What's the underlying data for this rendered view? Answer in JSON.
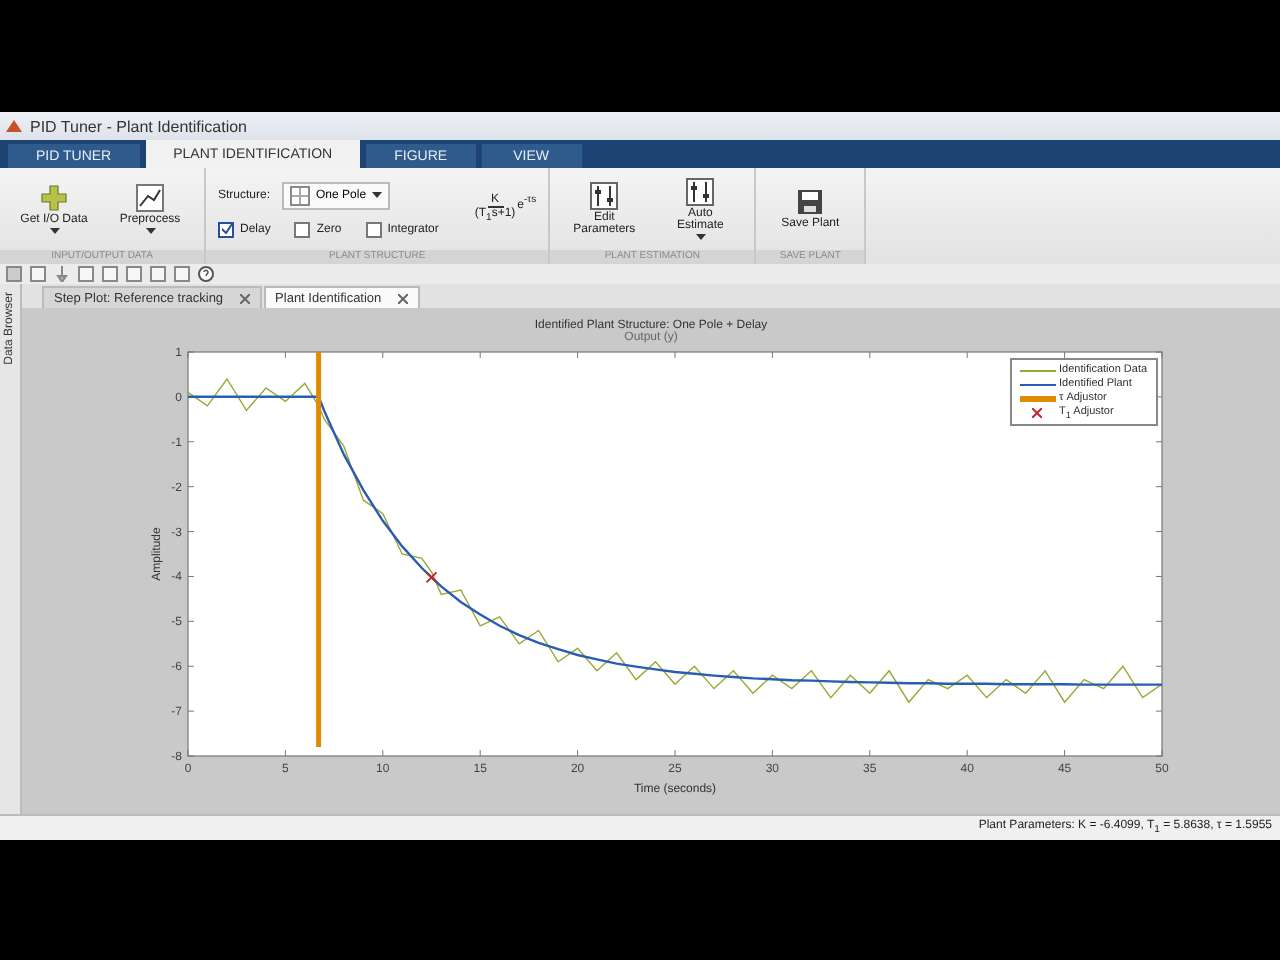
{
  "window": {
    "title": "PID Tuner - Plant Identification"
  },
  "tabs": [
    {
      "label": "PID TUNER",
      "selected": false
    },
    {
      "label": "PLANT IDENTIFICATION",
      "selected": true
    },
    {
      "label": "FIGURE",
      "selected": false
    },
    {
      "label": "VIEW",
      "selected": false
    }
  ],
  "io_data": {
    "label": "INPUT/OUTPUT DATA",
    "buttons": [
      {
        "kind": "plus",
        "label": "Get I/O Data"
      },
      {
        "kind": "chart",
        "label": "Preprocess"
      }
    ]
  },
  "plant_structure": {
    "label": "PLANT STRUCTURE",
    "structure_label": "Structure:",
    "structure_value": "One Pole",
    "numerator": "K",
    "denominator": "(T$_{1}$s+1)",
    "exponent": "e$^{-τs}$",
    "options": [
      {
        "label": "Delay",
        "checked": true
      },
      {
        "label": "Zero",
        "checked": false
      },
      {
        "label": "Integrator",
        "checked": false
      }
    ]
  },
  "plant_estimation": {
    "label": "PLANT ESTIMATION",
    "buttons": [
      {
        "label": "Edit Parameters",
        "dropdown": false
      },
      {
        "label": "Auto Estimate",
        "dropdown": true
      }
    ]
  },
  "save_plant": {
    "label": "SAVE PLANT",
    "button": "Save Plant"
  },
  "side_panel": {
    "label": "Data Browser"
  },
  "document_tabs": [
    {
      "label": "Step Plot: Reference tracking",
      "selected": false
    },
    {
      "label": "Plant Identification",
      "selected": true
    }
  ],
  "figure": {
    "title": "Identified Plant Structure: One Pole + Delay",
    "subtitle": "Output (y)",
    "chart_data": {
      "type": "line",
      "xlabel": "Time (seconds)",
      "ylabel": "Amplitude",
      "x": [
        0,
        1,
        2,
        3,
        4,
        5,
        6,
        6.7,
        6.7,
        7,
        8,
        9,
        10,
        11,
        12,
        12.5,
        13,
        14,
        15,
        16,
        17,
        18,
        19,
        20,
        21,
        22,
        23,
        24,
        25,
        26,
        27,
        28,
        29,
        30,
        31,
        32,
        33,
        34,
        35,
        36,
        37,
        38,
        39,
        40,
        41,
        42,
        43,
        44,
        45,
        46,
        47,
        48,
        49,
        50
      ],
      "series": [
        {
          "name": "Identification Data",
          "color": "#9aa832",
          "values": [
            0.1,
            -0.2,
            0.4,
            -0.3,
            0.2,
            -0.1,
            0.3,
            -0.2,
            -0.2,
            -0.5,
            -1.1,
            -2.3,
            -2.6,
            -3.5,
            -3.6,
            -3.9,
            -4.4,
            -4.3,
            -5.1,
            -4.9,
            -5.5,
            -5.2,
            -5.9,
            -5.6,
            -6.1,
            -5.7,
            -6.3,
            -5.9,
            -6.4,
            -6.0,
            -6.5,
            -6.1,
            -6.6,
            -6.2,
            -6.5,
            -6.1,
            -6.7,
            -6.2,
            -6.6,
            -6.1,
            -6.8,
            -6.3,
            -6.5,
            -6.2,
            -6.7,
            -6.3,
            -6.6,
            -6.1,
            -6.8,
            -6.3,
            -6.5,
            -6.0,
            -6.7,
            -6.4
          ]
        },
        {
          "name": "Identified Plant",
          "color": "#2a5db0",
          "values": [
            0,
            0,
            0,
            0,
            0,
            0,
            0,
            0,
            0,
            -0.32,
            -1.28,
            -2.08,
            -2.76,
            -3.33,
            -3.81,
            -4.02,
            -4.22,
            -4.57,
            -4.85,
            -5.1,
            -5.31,
            -5.48,
            -5.62,
            -5.75,
            -5.85,
            -5.94,
            -6.01,
            -6.07,
            -6.13,
            -6.17,
            -6.21,
            -6.24,
            -6.27,
            -6.29,
            -6.31,
            -6.32,
            -6.34,
            -6.35,
            -6.36,
            -6.37,
            -6.38,
            -6.38,
            -6.39,
            -6.39,
            -6.39,
            -6.4,
            -6.4,
            -6.4,
            -6.4,
            -6.41,
            -6.41,
            -6.41,
            -6.41,
            -6.41
          ]
        },
        {
          "name": "τ Adjustor",
          "color": "#e08a00",
          "values": [
            null,
            null,
            null,
            null,
            null,
            null,
            null,
            1,
            -7.8,
            null,
            null,
            null,
            null,
            null,
            null,
            null,
            null,
            null,
            null,
            null,
            null,
            null,
            null,
            null,
            null,
            null,
            null,
            null,
            null,
            null,
            null,
            null,
            null,
            null,
            null,
            null,
            null,
            null,
            null,
            null,
            null,
            null,
            null,
            null,
            null,
            null,
            null,
            null,
            null,
            null,
            null,
            null,
            null,
            null
          ]
        },
        {
          "name": "T$_{1}$ Adjustor",
          "color": "#c0282d",
          "marker": "x",
          "values": [
            null,
            null,
            null,
            null,
            null,
            null,
            null,
            null,
            null,
            null,
            null,
            null,
            null,
            null,
            null,
            -4.02,
            null,
            null,
            null,
            null,
            null,
            null,
            null,
            null,
            null,
            null,
            null,
            null,
            null,
            null,
            null,
            null,
            null,
            null,
            null,
            null,
            null,
            null,
            null,
            null,
            null,
            null,
            null,
            null,
            null,
            null,
            null,
            null,
            null,
            null,
            null,
            null,
            null,
            null
          ]
        }
      ],
      "xlim": [
        0,
        50
      ],
      "ylim": [
        -8,
        1
      ],
      "xticks": [
        0,
        5,
        10,
        15,
        20,
        25,
        30,
        35,
        40,
        45,
        50
      ],
      "yticks": [
        -8,
        -7,
        -6,
        -5,
        -4,
        -3,
        -2,
        -1,
        0,
        1
      ],
      "legend": "upper right"
    }
  },
  "status_bar": {
    "text": "Plant Parameters: K = -6.4099, T$_{1}$ = 5.8638, τ = 1.5955"
  }
}
